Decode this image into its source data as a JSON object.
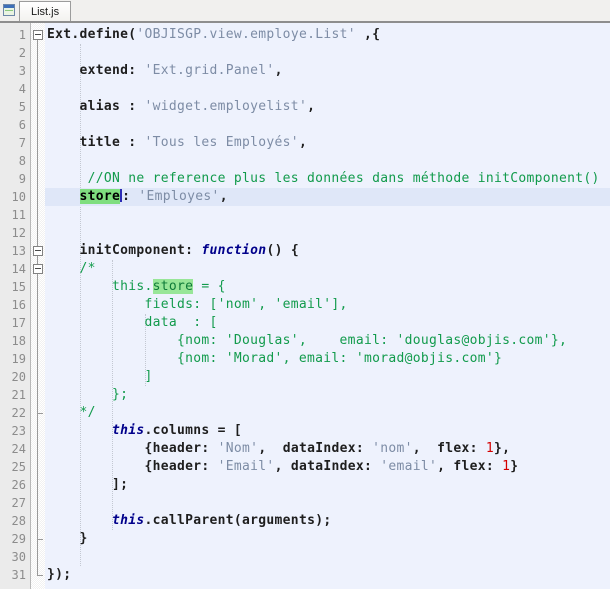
{
  "tab": {
    "label": "List.js",
    "file_icon": "window-file-icon"
  },
  "editor": {
    "language": "javascript",
    "line_count": 31,
    "current_line": 10,
    "selection": {
      "line": 10,
      "text": "store"
    },
    "occurrence_highlight": {
      "line": 15,
      "text": "store"
    },
    "fold": {
      "boxes": [
        1,
        13,
        14
      ],
      "end_ticks": [
        22,
        29,
        31
      ],
      "line_from": 1,
      "line_to": 31
    },
    "guides": [
      {
        "col": 4,
        "from": 2,
        "to": 30
      },
      {
        "col": 8,
        "from": 14,
        "to": 28
      },
      {
        "col": 12,
        "from": 17,
        "to": 20
      }
    ],
    "lines": [
      {
        "n": 1,
        "segs": [
          [
            "code",
            "Ext.define("
          ],
          [
            "str",
            "'OBJISGP.view.employe.List'"
          ],
          [
            "code",
            " ,{"
          ]
        ]
      },
      {
        "n": 2,
        "segs": []
      },
      {
        "n": 3,
        "segs": [
          [
            "code",
            "    extend: "
          ],
          [
            "str",
            "'Ext.grid.Panel'"
          ],
          [
            "code",
            ","
          ]
        ]
      },
      {
        "n": 4,
        "segs": []
      },
      {
        "n": 5,
        "segs": [
          [
            "code",
            "    alias : "
          ],
          [
            "str",
            "'widget.employelist'"
          ],
          [
            "code",
            ","
          ]
        ]
      },
      {
        "n": 6,
        "segs": []
      },
      {
        "n": 7,
        "segs": [
          [
            "code",
            "    title : "
          ],
          [
            "str",
            "'Tous les Employés'"
          ],
          [
            "code",
            ","
          ]
        ]
      },
      {
        "n": 8,
        "segs": []
      },
      {
        "n": 9,
        "segs": [
          [
            "cmt",
            "     //ON ne reference plus les données dans méthode initComponent()"
          ]
        ]
      },
      {
        "n": 10,
        "cur": true,
        "segs": [
          [
            "code",
            "    "
          ],
          [
            "sel",
            "store"
          ],
          [
            "caret",
            ""
          ],
          [
            "code",
            ": "
          ],
          [
            "str",
            "'Employes'"
          ],
          [
            "code",
            ","
          ]
        ]
      },
      {
        "n": 11,
        "segs": []
      },
      {
        "n": 12,
        "segs": []
      },
      {
        "n": 13,
        "segs": [
          [
            "code",
            "    initComponent: "
          ],
          [
            "kw",
            "function"
          ],
          [
            "code",
            "() {"
          ]
        ]
      },
      {
        "n": 14,
        "segs": [
          [
            "cmt",
            "    /*"
          ]
        ]
      },
      {
        "n": 15,
        "segs": [
          [
            "cmt",
            "        this."
          ],
          [
            "occ",
            "store"
          ],
          [
            "cmt",
            " = {"
          ]
        ]
      },
      {
        "n": 16,
        "segs": [
          [
            "cmt",
            "            fields: ['nom', 'email'],"
          ]
        ]
      },
      {
        "n": 17,
        "segs": [
          [
            "cmt",
            "            data  : ["
          ]
        ]
      },
      {
        "n": 18,
        "segs": [
          [
            "cmt",
            "                {nom: 'Douglas',    email: 'douglas@objis.com'},"
          ]
        ]
      },
      {
        "n": 19,
        "segs": [
          [
            "cmt",
            "                {nom: 'Morad', email: 'morad@objis.com'}"
          ]
        ]
      },
      {
        "n": 20,
        "segs": [
          [
            "cmt",
            "            ]"
          ]
        ]
      },
      {
        "n": 21,
        "segs": [
          [
            "cmt",
            "        };"
          ]
        ]
      },
      {
        "n": 22,
        "segs": [
          [
            "cmt",
            "    */"
          ]
        ]
      },
      {
        "n": 23,
        "segs": [
          [
            "code",
            "        "
          ],
          [
            "kw",
            "this"
          ],
          [
            "code",
            ".columns = ["
          ]
        ]
      },
      {
        "n": 24,
        "segs": [
          [
            "code",
            "            {header: "
          ],
          [
            "str",
            "'Nom'"
          ],
          [
            "code",
            ",  dataIndex: "
          ],
          [
            "str",
            "'nom'"
          ],
          [
            "code",
            ",  flex: "
          ],
          [
            "num",
            "1"
          ],
          [
            "code",
            "},"
          ]
        ]
      },
      {
        "n": 25,
        "segs": [
          [
            "code",
            "            {header: "
          ],
          [
            "str",
            "'Email'"
          ],
          [
            "code",
            ", dataIndex: "
          ],
          [
            "str",
            "'email'"
          ],
          [
            "code",
            ", flex: "
          ],
          [
            "num",
            "1"
          ],
          [
            "code",
            "}"
          ]
        ]
      },
      {
        "n": 26,
        "segs": [
          [
            "code",
            "        ];"
          ]
        ]
      },
      {
        "n": 27,
        "segs": []
      },
      {
        "n": 28,
        "segs": [
          [
            "code",
            "        "
          ],
          [
            "kw",
            "this"
          ],
          [
            "code",
            ".callParent(arguments);"
          ]
        ]
      },
      {
        "n": 29,
        "segs": [
          [
            "code",
            "    }"
          ]
        ]
      },
      {
        "n": 30,
        "segs": []
      },
      {
        "n": 31,
        "segs": [
          [
            "code",
            "});"
          ]
        ]
      }
    ]
  },
  "colors": {
    "editor_bg": "#EEF2FD",
    "gutter_bg": "#EBEBEB",
    "gutter_text": "#8C8C8C",
    "current_line_bg": "#DFE7F8",
    "code_text": "#1E1E1E",
    "string_text": "#7D8CA5",
    "comment_text": "#129B4C",
    "keyword_text": "#00008B",
    "number_text": "#D40000",
    "selection_bg": "#7FDE7F",
    "occurrence_bg": "#98E698",
    "occurrence_text": "#0E7A38",
    "caret_color": "#2B2BB5",
    "tab_strip_bg": "#F1F0EE",
    "strip_border": "#8E8E8E",
    "fold_line": "#9A9A9A"
  }
}
